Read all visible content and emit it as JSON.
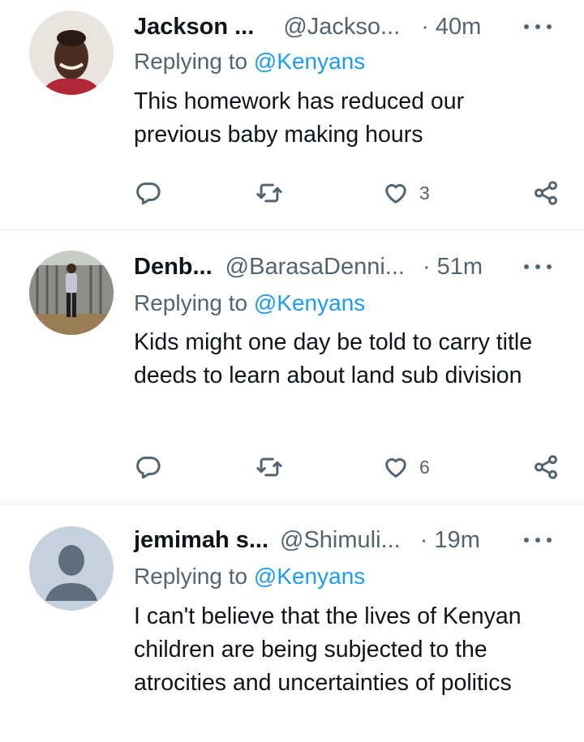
{
  "tweets": [
    {
      "name": "Jackson ...",
      "handle": "@Jackso...",
      "time": "· 40m",
      "replying_prefix": "Replying to ",
      "replying_to": "@Kenyans",
      "text": "This homework has reduced our previous baby making hours",
      "likes": "3",
      "avatar": "photo-man-smiling"
    },
    {
      "name": "Denb...",
      "handle": "@BarasaDenni...",
      "time": "· 51m",
      "replying_prefix": "Replying to ",
      "replying_to": "@Kenyans",
      "text": "Kids might one day be told to carry title deeds to learn about land sub division",
      "likes": "6",
      "avatar": "photo-man-standing-by-gate"
    },
    {
      "name": "jemimah s...",
      "handle": "@Shimuli...",
      "time": "· 19m",
      "replying_prefix": "Replying to ",
      "replying_to": "@Kenyans",
      "text": "I can't believe that the lives of Kenyan children are being subjected to the atrocities and uncertainties of politics",
      "likes": "",
      "avatar": "default-avatar-silhouette"
    }
  ],
  "colors": {
    "link": "#1d9bf0",
    "secondary_text": "#536471",
    "divider": "#e6ecf0"
  },
  "icons": [
    "reply-icon",
    "retweet-icon",
    "like-icon",
    "share-icon",
    "more-options-icon"
  ]
}
